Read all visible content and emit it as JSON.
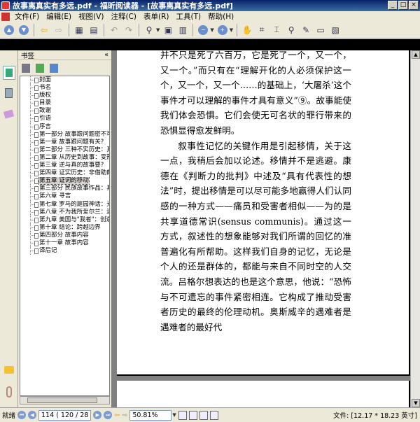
{
  "window": {
    "title": "故事离真实有多远.pdf - 福昕阅读器 - [故事离真实有多远.pdf]",
    "buttons": [
      "_",
      "□",
      "×"
    ]
  },
  "menu": {
    "items": [
      "文件(F)",
      "编辑(E)",
      "视图(V)",
      "注释(C)",
      "表单(R)",
      "工具(T)",
      "帮助(H)"
    ]
  },
  "toolbar": {
    "icons": [
      "prev-page-icon",
      "next-page-icon",
      "back-icon",
      "forward-icon",
      "page-layout-icon",
      "rotate-icon",
      "undo-icon",
      "redo-icon",
      "zoom-in-icon",
      "fit-page-icon",
      "fit-width-icon",
      "zoom-out-icon",
      "zoom-add-icon",
      "hand-tool-icon",
      "snapshot-icon",
      "select-text-icon",
      "find-icon",
      "note-icon",
      "image-icon"
    ]
  },
  "bookmarks": {
    "header": "书签",
    "collapse": "«",
    "items": [
      "封面",
      "书名",
      "版权",
      "目录",
      "致谢",
      "引语",
      "序言",
      "第一部分  故事跟问题密不可分",
      "第一章  故事跟问题有关?",
      "第二部分  三种不实历史：真实",
      "第二章  从历史到故事：变形",
      "第三章  逆与真的故事要?",
      "第四章  证实历史：非借助的",
      "第五章  证词的移动",
      "第三部分  民族故事作品：真",
      "第六章  寻言",
      "第七章  罗马的庭园神话：光",
      "第八章  不为我所爱尔兰：迷",
      "第九章  美国与\"我者\"：创造",
      "第十章  结论：跨越边界",
      "第四部分  故事内容",
      "第十一章  故事内容",
      "译后记"
    ],
    "selected_index": 13
  },
  "document": {
    "paragraphs": [
      {
        "indent": false,
        "text": "并不只是死了六百万，它是死了一个，又一个，又一个。”而只有在“理解开化的人必须保护这一个，又一个，又一个……的基础上，‘大屠杀’这个事件才可以理解的事件才具有意义”⑨。故事能使我们体会恐惧。它们会使无可名状的罪行带来的恐惧显得愈发鲜明。"
      },
      {
        "indent": true,
        "text": "叙事性记忆的关键作用是引起移情，关于这一点，我稍后会加以论述。移情并不是逃避。康德在《判断力的批判》中述及“具有代表性的想法”时，提出移情是可以尽可能多地赢得人们认同感的一种方式——痛员和受害者相似——为的是共享道德常识(sensus communis)。通过这一方式，叙述性的想象能够对我们所谓的回忆的准普遍化有所帮助。这样我们自身的记忆，无论是个人的还是群体的，都能与来自不同时空的人交流。吕格尔想表达的也是这个意思，他说：“恐怖与不可遗忘的事件紧密相连。它构成了推动受害者历史的最终的伦理动机。奥斯威辛的遇难者是遇难者的最好代"
      }
    ]
  },
  "status": {
    "ready": "就绪",
    "page_number": "114",
    "page_info": "( 120 / 28",
    "zoom": "50.81%",
    "file_size": "文件: [12.17 * 18.23 英寸]"
  }
}
